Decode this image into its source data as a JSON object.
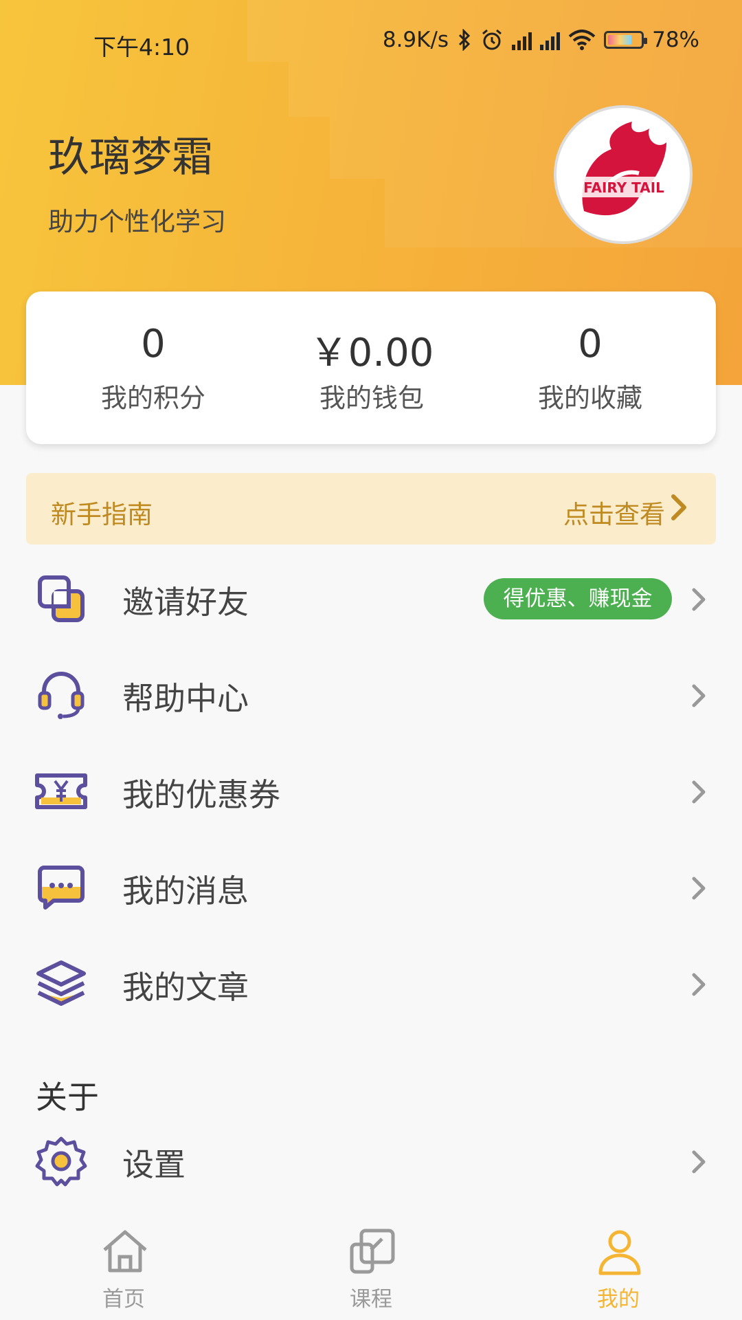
{
  "status_bar": {
    "time": "下午4:10",
    "net_speed": "8.9K/s",
    "battery": "78%",
    "icons": [
      "bluetooth-icon",
      "alarm-icon",
      "signal-icon",
      "hd-signal-icon",
      "wifi-icon",
      "battery-icon"
    ]
  },
  "profile": {
    "name": "玖璃梦霜",
    "subtitle": "助力个性化学习",
    "avatar_icon": "fairy-tail-avatar"
  },
  "stats": [
    {
      "value": "0",
      "label": "我的积分"
    },
    {
      "value": "￥0.00",
      "label": "我的钱包"
    },
    {
      "value": "0",
      "label": "我的收藏"
    }
  ],
  "guide": {
    "title": "新手指南",
    "link": "点击查看"
  },
  "menu": [
    {
      "label": "邀请好友",
      "icon": "invite-icon",
      "badge": "得优惠、赚现金"
    },
    {
      "label": "帮助中心",
      "icon": "headset-icon"
    },
    {
      "label": "我的优惠券",
      "icon": "coupon-icon"
    },
    {
      "label": "我的消息",
      "icon": "message-icon"
    },
    {
      "label": "我的文章",
      "icon": "layers-icon"
    }
  ],
  "about": {
    "title": "关于",
    "settings_label": "设置"
  },
  "tabs": [
    {
      "label": "首页",
      "icon": "home-icon"
    },
    {
      "label": "课程",
      "icon": "course-icon"
    },
    {
      "label": "我的",
      "icon": "profile-icon"
    }
  ],
  "colors": {
    "accent": "#f5b533",
    "icon_purple": "#5b4f9e",
    "icon_yellow": "#f6c23e",
    "badge_green": "#4caf50",
    "guide_text": "#c08a22"
  }
}
